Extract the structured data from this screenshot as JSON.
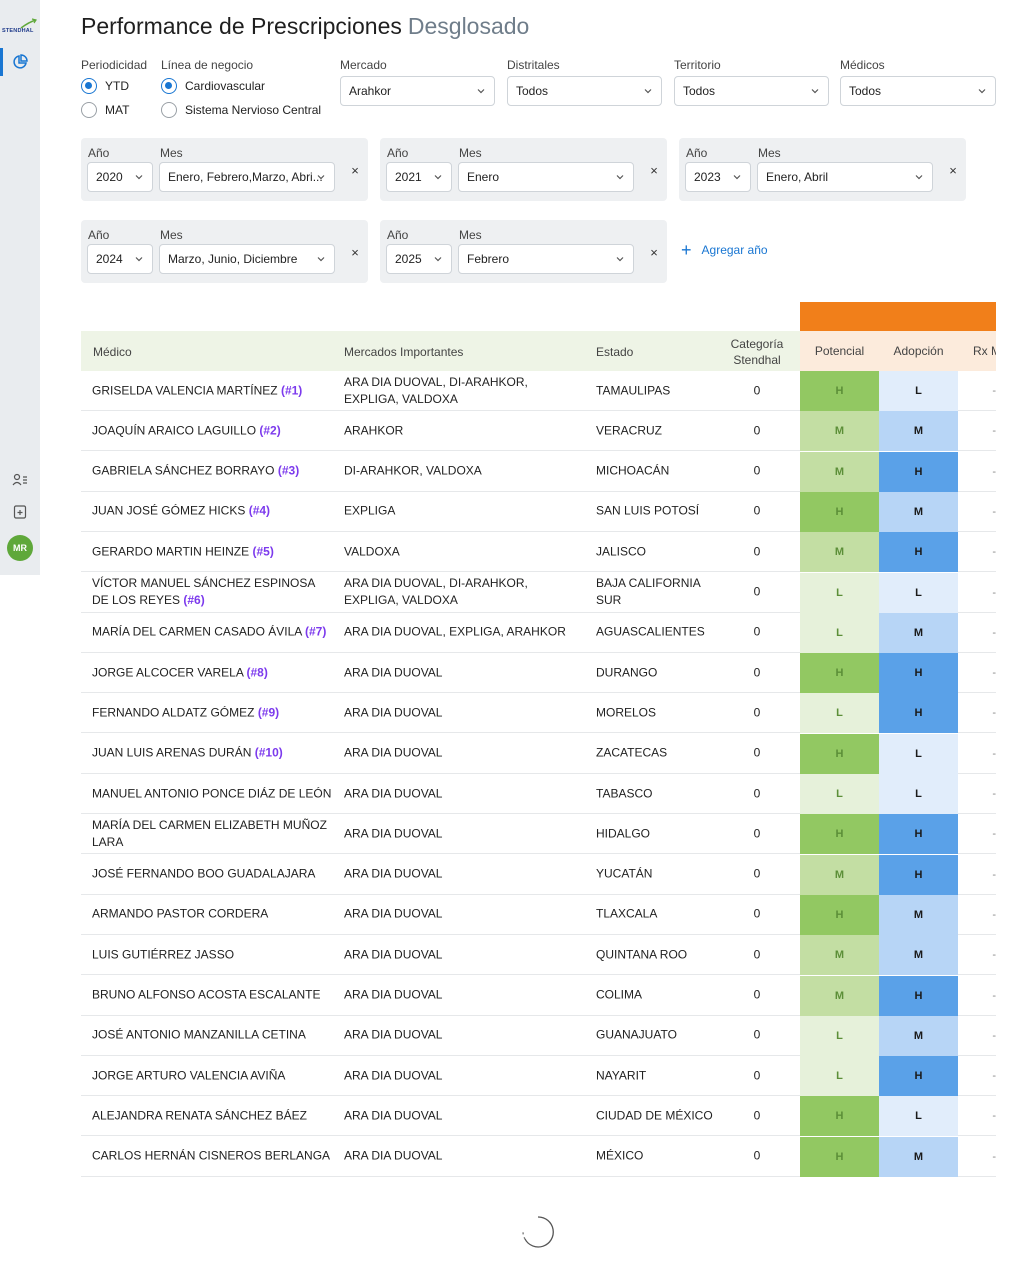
{
  "brand": {
    "logo_text": "STENDHAL"
  },
  "user": {
    "initials": "MR"
  },
  "page": {
    "title": "Performance de Prescripciones",
    "subtitle": "Desglosado"
  },
  "filters": {
    "periodicidad": {
      "label": "Periodicidad",
      "options": [
        "YTD",
        "MAT"
      ],
      "selected": "YTD"
    },
    "linea": {
      "label": "Línea de negocio",
      "options": [
        "Cardiovascular",
        "Sistema Nervioso Central"
      ],
      "selected": "Cardiovascular"
    },
    "mercado": {
      "label": "Mercado",
      "value": "Arahkor"
    },
    "distritales": {
      "label": "Distritales",
      "value": "Todos"
    },
    "territorio": {
      "label": "Territorio",
      "value": "Todos"
    },
    "medicos": {
      "label": "Médicos",
      "value": "Todos"
    }
  },
  "year_panels": [
    {
      "year_label": "Año",
      "month_label": "Mes",
      "year": "2020",
      "months": "Enero, Febrero,Marzo, Abri..."
    },
    {
      "year_label": "Año",
      "month_label": "Mes",
      "year": "2021",
      "months": "Enero"
    },
    {
      "year_label": "Año",
      "month_label": "Mes",
      "year": "2023",
      "months": "Enero, Abril"
    },
    {
      "year_label": "Año",
      "month_label": "Mes",
      "year": "2024",
      "months": "Marzo, Junio, Diciembre"
    },
    {
      "year_label": "Año",
      "month_label": "Mes",
      "year": "2025",
      "months": "Febrero"
    }
  ],
  "close_symbol": "×",
  "add_year": {
    "icon": "+",
    "label": "Agregar año"
  },
  "table": {
    "headers": {
      "medico": "Médico",
      "mercados": "Mercados Importantes",
      "estado": "Estado",
      "categoria_line1": "Categoría",
      "categoria_line2": "Stendhal",
      "potencial": "Potencial",
      "adopcion": "Adopción",
      "rx": "Rx M"
    },
    "rows": [
      {
        "name": "GRISELDA VALENCIA MARTÍNEZ",
        "rank": "(#1)",
        "markets": "ARA DIA DUOVAL, DI-ARAHKOR, EXPLIGA, VALDOXA",
        "state": "TAMAULIPAS",
        "cat": "0",
        "pot": "H",
        "adop": "L"
      },
      {
        "name": "JOAQUÍN ARAICO LAGUILLO",
        "rank": "(#2)",
        "markets": "ARAHKOR",
        "state": "VERACRUZ",
        "cat": "0",
        "pot": "M",
        "adop": "M"
      },
      {
        "name": "GABRIELA SÁNCHEZ BORRAYO",
        "rank": "(#3)",
        "markets": "DI-ARAHKOR, VALDOXA",
        "state": "MICHOACÁN",
        "cat": "0",
        "pot": "M",
        "adop": "H"
      },
      {
        "name": "JUAN JOSÉ GÓMEZ HICKS",
        "rank": "(#4)",
        "markets": "EXPLIGA",
        "state": "SAN LUIS POTOSÍ",
        "cat": "0",
        "pot": "H",
        "adop": "M"
      },
      {
        "name": "GERARDO MARTIN HEINZE",
        "rank": "(#5)",
        "markets": "VALDOXA",
        "state": "JALISCO",
        "cat": "0",
        "pot": "M",
        "adop": "H"
      },
      {
        "name": "VÍCTOR MANUEL SÁNCHEZ ESPINOSA DE LOS REYES",
        "rank": "(#6)",
        "markets": "ARA DIA DUOVAL, DI-ARAHKOR, EXPLIGA, VALDOXA",
        "state": "BAJA CALIFORNIA SUR",
        "cat": "0",
        "pot": "L",
        "adop": "L"
      },
      {
        "name": "MARÍA DEL CARMEN CASADO ÁVILA",
        "rank": "(#7)",
        "markets": "ARA DIA DUOVAL, EXPLIGA, ARAHKOR",
        "state": "AGUASCALIENTES",
        "cat": "0",
        "pot": "L",
        "adop": "M"
      },
      {
        "name": "JORGE ALCOCER VARELA",
        "rank": "(#8)",
        "markets": "ARA DIA DUOVAL",
        "state": "DURANGO",
        "cat": "0",
        "pot": "H",
        "adop": "H"
      },
      {
        "name": "FERNANDO ALDATZ GÓMEZ",
        "rank": "(#9)",
        "markets": "ARA DIA DUOVAL",
        "state": "MORELOS",
        "cat": "0",
        "pot": "L",
        "adop": "H"
      },
      {
        "name": "JUAN LUIS ARENAS DURÁN",
        "rank": "(#10)",
        "markets": "ARA DIA DUOVAL",
        "state": "ZACATECAS",
        "cat": "0",
        "pot": "H",
        "adop": "L"
      },
      {
        "name": "MANUEL ANTONIO PONCE DIÁZ DE LEÓN",
        "rank": "",
        "markets": "ARA DIA DUOVAL",
        "state": "TABASCO",
        "cat": "0",
        "pot": "L",
        "adop": "L"
      },
      {
        "name": "MARÍA DEL CARMEN ELIZABETH MUÑOZ LARA",
        "rank": "",
        "markets": "ARA DIA DUOVAL",
        "state": "HIDALGO",
        "cat": "0",
        "pot": "H",
        "adop": "H"
      },
      {
        "name": "JOSÉ FERNANDO BOO GUADALAJARA",
        "rank": "",
        "markets": "ARA DIA DUOVAL",
        "state": "YUCATÁN",
        "cat": "0",
        "pot": "M",
        "adop": "H"
      },
      {
        "name": "ARMANDO PASTOR CORDERA",
        "rank": "",
        "markets": "ARA DIA DUOVAL",
        "state": "TLAXCALA",
        "cat": "0",
        "pot": "H",
        "adop": "M"
      },
      {
        "name": "LUIS GUTIÉRREZ JASSO",
        "rank": "",
        "markets": "ARA DIA DUOVAL",
        "state": "QUINTANA ROO",
        "cat": "0",
        "pot": "M",
        "adop": "M"
      },
      {
        "name": "BRUNO ALFONSO ACOSTA ESCALANTE",
        "rank": "",
        "markets": "ARA DIA DUOVAL",
        "state": "COLIMA",
        "cat": "0",
        "pot": "M",
        "adop": "H"
      },
      {
        "name": "JOSÉ ANTONIO MANZANILLA CETINA",
        "rank": "",
        "markets": "ARA DIA DUOVAL",
        "state": "GUANAJUATO",
        "cat": "0",
        "pot": "L",
        "adop": "M"
      },
      {
        "name": "JORGE ARTURO VALENCIA AVIÑA",
        "rank": "",
        "markets": "ARA DIA DUOVAL",
        "state": "NAYARIT",
        "cat": "0",
        "pot": "L",
        "adop": "H"
      },
      {
        "name": "ALEJANDRA RENATA SÁNCHEZ BÁEZ",
        "rank": "",
        "markets": "ARA DIA DUOVAL",
        "state": "CIUDAD DE MÉXICO",
        "cat": "0",
        "pot": "H",
        "adop": "L"
      },
      {
        "name": "CARLOS HERNÁN CISNEROS BERLANGA",
        "rank": "",
        "markets": "ARA DIA DUOVAL",
        "state": "MÉXICO",
        "cat": "0",
        "pot": "H",
        "adop": "M"
      }
    ],
    "trailing_mark": "-"
  },
  "colors": {
    "accent": "#1976d2",
    "orange_header": "#f17f1a",
    "green_header_bg": "#eef4e6",
    "peach_header_bg": "#fcebdc",
    "rank_purple": "#7c3aed",
    "potential": {
      "H": "#92c862",
      "M": "#c3dea3",
      "L": "#e6f1da"
    },
    "adoption": {
      "H": "#5aa1e8",
      "M": "#b7d5f6",
      "L": "#e1edfb"
    }
  },
  "icons": {
    "nav": [
      "chart-pie-icon",
      "user-list-icon",
      "document-add-icon"
    ],
    "loading": "spinner-icon"
  }
}
